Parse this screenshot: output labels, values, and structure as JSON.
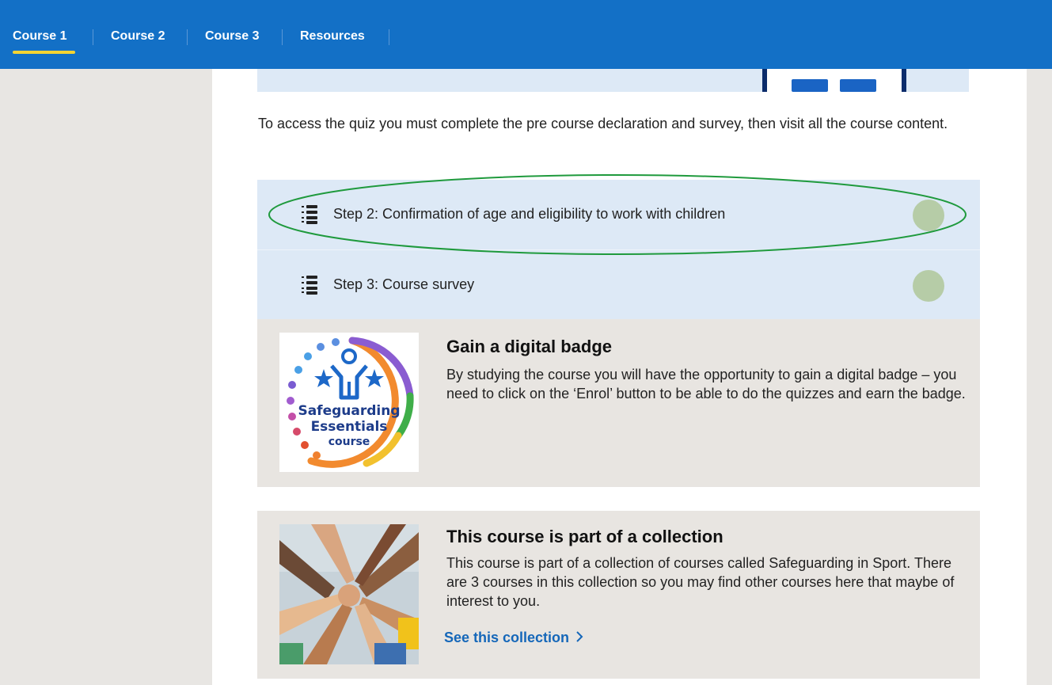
{
  "nav": {
    "tabs": [
      {
        "label": "Course 1",
        "active": true
      },
      {
        "label": "Course 2",
        "active": false
      },
      {
        "label": "Course 3",
        "active": false
      },
      {
        "label": "Resources",
        "active": false
      }
    ],
    "accent": "#1370c6",
    "active_underline": "#f4d433"
  },
  "intro_text": "To access the quiz you must complete the pre course declaration and survey, then visit all the course content.",
  "steps": [
    {
      "label": "Step 2: Confirmation of age and eligibility to work with children",
      "icon": "checklist-icon",
      "status": "complete",
      "highlighted": true
    },
    {
      "label": "Step 3: Course survey",
      "icon": "checklist-icon",
      "status": "complete",
      "highlighted": false
    }
  ],
  "badge_card": {
    "title": "Gain a digital badge",
    "text": "By studying the course you will have the opportunity to gain a digital badge – you need to click on the ‘Enrol’ button to be able to do the quizzes and earn the badge.",
    "image_lines": [
      "Safeguarding",
      "Essentials",
      "course"
    ]
  },
  "collection_card": {
    "title": "This course is part of a collection",
    "text": "This course is part of a collection of courses called Safeguarding in Sport. There are 3 courses in this collection so you may find other courses here that maybe of interest to you.",
    "link_label": "See this collection",
    "link_icon": "chevron-right-icon"
  }
}
